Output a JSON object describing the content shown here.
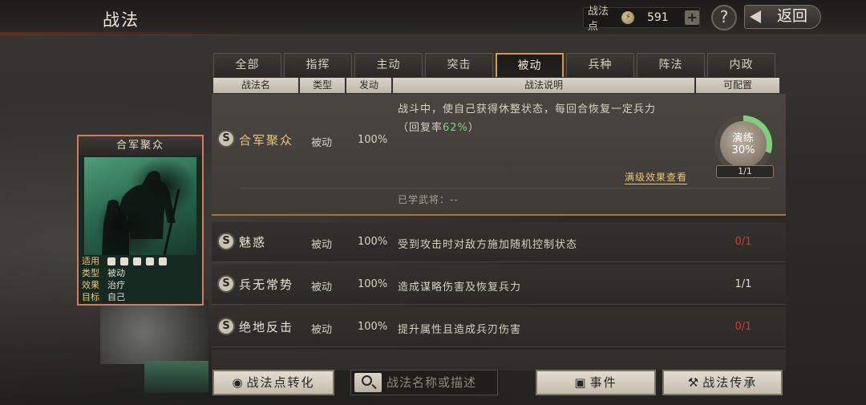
{
  "topbar": {
    "title": "战法",
    "points_label": "战法点",
    "points_value": "591",
    "back_label": "返回"
  },
  "tabs": [
    "全部",
    "指挥",
    "主动",
    "突击",
    "被动",
    "兵种",
    "阵法",
    "内政"
  ],
  "active_tab": "被动",
  "columns": [
    "战法名",
    "类型",
    "发动",
    "战法说明",
    "可配置"
  ],
  "selected": {
    "name": "合军聚众",
    "type": "被动",
    "rate": "100%",
    "desc_line1": "战斗中，使自己获得休整状态，每回合恢复一定兵力",
    "desc_line2_pre": "（回复率",
    "desc_line2_val": "62%",
    "desc_line2_post": "）",
    "learned": "已学武将：--",
    "full_effect": "满级效果查看",
    "practice_label": "演练",
    "practice_pct": "30%",
    "practice_value": 0.3,
    "practice_count": "1/1"
  },
  "rows": [
    {
      "name": "魅惑",
      "type": "被动",
      "rate": "100%",
      "desc": "受到攻击时对敌方施加随机控制状态",
      "config": "0/1",
      "config_color": "#d23a2e"
    },
    {
      "name": "兵无常势",
      "type": "被动",
      "rate": "100%",
      "desc": "造成谋略伤害及恢复兵力",
      "config": "1/1",
      "config_color": "#e0dacb"
    },
    {
      "name": "绝地反击",
      "type": "被动",
      "rate": "100%",
      "desc": "提升属性且造成兵刃伤害",
      "config": "0/1",
      "config_color": "#d23a2e"
    }
  ],
  "card": {
    "title": "合军聚众",
    "apply_label": "适用",
    "type_label": "类型",
    "type_value": "被动",
    "effect_label": "效果",
    "effect_value": "治疗",
    "target_label": "目标",
    "target_value": "自己"
  },
  "bottom": {
    "convert_label": "战法点转化",
    "search_placeholder": "战法名称或描述",
    "event_label": "事件",
    "inherit_label": "战法传承"
  },
  "colors": {
    "accent": "#d49a4a",
    "gold_text": "#e8c77a",
    "green_text": "#7fd07c",
    "red_text": "#d23a2e"
  }
}
